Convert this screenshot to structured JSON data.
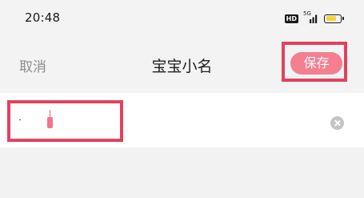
{
  "status_bar": {
    "time": "20:48",
    "network_badge": "HD",
    "signal_label": "5G",
    "battery_color": "#f6d33c"
  },
  "nav": {
    "cancel_label": "取消",
    "title": "宝宝小名",
    "save_label": "保存"
  },
  "form": {
    "name_value": "",
    "clear_icon": "clear-circle-icon"
  },
  "colors": {
    "accent": "#f37f90",
    "highlight": "#e3415f"
  }
}
